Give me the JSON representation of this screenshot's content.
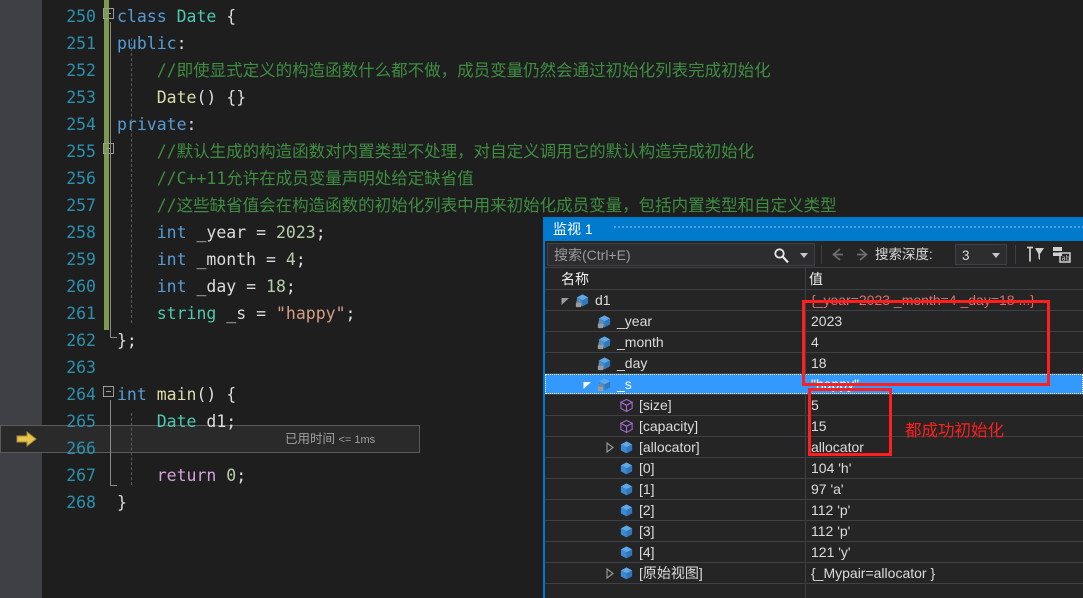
{
  "editor": {
    "lines": [
      {
        "num": "250",
        "tokens": [
          {
            "t": "class ",
            "c": "kw"
          },
          {
            "t": "Date",
            "c": "cls"
          },
          {
            "t": " {",
            "c": "plain"
          }
        ],
        "indent": 0
      },
      {
        "num": "251",
        "tokens": [
          {
            "t": "public",
            "c": "kw"
          },
          {
            "t": ":",
            "c": "plain"
          }
        ],
        "indent": 0
      },
      {
        "num": "252",
        "tokens": [
          {
            "t": "    //即使显式定义的构造函数什么都不做，成员变量仍然会通过初始化列表完成初始化",
            "c": "cmt"
          }
        ],
        "indent": 0
      },
      {
        "num": "253",
        "tokens": [
          {
            "t": "    ",
            "c": "plain"
          },
          {
            "t": "Date",
            "c": "fn"
          },
          {
            "t": "() {}",
            "c": "plain"
          }
        ],
        "indent": 0
      },
      {
        "num": "254",
        "tokens": [
          {
            "t": "private",
            "c": "kw"
          },
          {
            "t": ":",
            "c": "plain"
          }
        ],
        "indent": 0
      },
      {
        "num": "255",
        "tokens": [
          {
            "t": "    //默认生成的构造函数对内置类型不处理，对自定义调用它的默认构造完成初始化",
            "c": "cmt"
          }
        ],
        "indent": 0
      },
      {
        "num": "256",
        "tokens": [
          {
            "t": "    //C++11允许在成员变量声明处给定缺省值",
            "c": "cmt"
          }
        ],
        "indent": 0
      },
      {
        "num": "257",
        "tokens": [
          {
            "t": "    //这些缺省值会在构造函数的初始化列表中用来初始化成员变量，包括内置类型和自定义类型",
            "c": "cmt"
          }
        ],
        "indent": 0
      },
      {
        "num": "258",
        "tokens": [
          {
            "t": "    ",
            "c": "plain"
          },
          {
            "t": "int",
            "c": "kw"
          },
          {
            "t": " _year = ",
            "c": "plain"
          },
          {
            "t": "2023",
            "c": "num"
          },
          {
            "t": ";",
            "c": "plain"
          }
        ],
        "indent": 0
      },
      {
        "num": "259",
        "tokens": [
          {
            "t": "    ",
            "c": "plain"
          },
          {
            "t": "int",
            "c": "kw"
          },
          {
            "t": " _month = ",
            "c": "plain"
          },
          {
            "t": "4",
            "c": "num"
          },
          {
            "t": ";",
            "c": "plain"
          }
        ],
        "indent": 0
      },
      {
        "num": "260",
        "tokens": [
          {
            "t": "    ",
            "c": "plain"
          },
          {
            "t": "int",
            "c": "kw"
          },
          {
            "t": " _day = ",
            "c": "plain"
          },
          {
            "t": "18",
            "c": "num"
          },
          {
            "t": ";",
            "c": "plain"
          }
        ],
        "indent": 0
      },
      {
        "num": "261",
        "tokens": [
          {
            "t": "    ",
            "c": "plain"
          },
          {
            "t": "string",
            "c": "type"
          },
          {
            "t": " _s = ",
            "c": "plain"
          },
          {
            "t": "\"happy\"",
            "c": "str"
          },
          {
            "t": ";",
            "c": "plain"
          }
        ],
        "indent": 0
      },
      {
        "num": "262",
        "tokens": [
          {
            "t": "};",
            "c": "plain"
          }
        ],
        "indent": 0
      },
      {
        "num": "263",
        "tokens": [],
        "indent": 0
      },
      {
        "num": "264",
        "tokens": [
          {
            "t": "int",
            "c": "kw"
          },
          {
            "t": " ",
            "c": "plain"
          },
          {
            "t": "main",
            "c": "fn"
          },
          {
            "t": "() {",
            "c": "plain"
          }
        ],
        "indent": 0
      },
      {
        "num": "265",
        "tokens": [
          {
            "t": "    ",
            "c": "plain"
          },
          {
            "t": "Date",
            "c": "cls"
          },
          {
            "t": " d1;",
            "c": "plain"
          }
        ],
        "indent": 0
      },
      {
        "num": "266",
        "tokens": [],
        "indent": 0
      },
      {
        "num": "267",
        "tokens": [
          {
            "t": "    ",
            "c": "plain"
          },
          {
            "t": "return",
            "c": "ctl"
          },
          {
            "t": " ",
            "c": "plain"
          },
          {
            "t": "0",
            "c": "num"
          },
          {
            "t": ";",
            "c": "plain"
          }
        ],
        "indent": 0
      },
      {
        "num": "268",
        "tokens": [
          {
            "t": "}",
            "c": "plain"
          }
        ],
        "indent": 0
      }
    ],
    "elapsed_label": "已用时间",
    "elapsed_value": "<= 1ms",
    "current_line_marker": "execution-pointer-arrow"
  },
  "watch": {
    "title": "监视 1",
    "search_placeholder": "搜索(Ctrl+E)",
    "depth_label": "搜索深度:",
    "depth_value": "3",
    "columns": {
      "name": "名称",
      "value": "值"
    },
    "rows": [
      {
        "indent": 0,
        "expander": "expanded",
        "icon": "blue-cube-lock-icon",
        "name": "d1",
        "value": "{_year=2023 _month=4 _day=18 ...}",
        "changed": true,
        "selected": false
      },
      {
        "indent": 1,
        "expander": "none",
        "icon": "blue-cube-lock-icon",
        "name": "_year",
        "value": "2023",
        "changed": false,
        "selected": false
      },
      {
        "indent": 1,
        "expander": "none",
        "icon": "blue-cube-lock-icon",
        "name": "_month",
        "value": "4",
        "changed": false,
        "selected": false
      },
      {
        "indent": 1,
        "expander": "none",
        "icon": "blue-cube-lock-icon",
        "name": "_day",
        "value": "18",
        "changed": false,
        "selected": false
      },
      {
        "indent": 1,
        "expander": "expanded",
        "icon": "blue-cube-lock-icon",
        "name": "_s",
        "value": "\"happy\"",
        "changed": false,
        "selected": true
      },
      {
        "indent": 2,
        "expander": "none",
        "icon": "purple-cube-icon",
        "name": "[size]",
        "value": "5",
        "changed": false,
        "selected": false
      },
      {
        "indent": 2,
        "expander": "none",
        "icon": "purple-cube-icon",
        "name": "[capacity]",
        "value": "15",
        "changed": false,
        "selected": false
      },
      {
        "indent": 2,
        "expander": "collapsed",
        "icon": "blue-cube-icon",
        "name": "[allocator]",
        "value": "allocator",
        "changed": false,
        "selected": false
      },
      {
        "indent": 2,
        "expander": "none",
        "icon": "blue-cube-icon",
        "name": "[0]",
        "value": "104 'h'",
        "changed": false,
        "selected": false
      },
      {
        "indent": 2,
        "expander": "none",
        "icon": "blue-cube-icon",
        "name": "[1]",
        "value": "97 'a'",
        "changed": false,
        "selected": false
      },
      {
        "indent": 2,
        "expander": "none",
        "icon": "blue-cube-icon",
        "name": "[2]",
        "value": "112 'p'",
        "changed": false,
        "selected": false
      },
      {
        "indent": 2,
        "expander": "none",
        "icon": "blue-cube-icon",
        "name": "[3]",
        "value": "112 'p'",
        "changed": false,
        "selected": false
      },
      {
        "indent": 2,
        "expander": "none",
        "icon": "blue-cube-icon",
        "name": "[4]",
        "value": "121 'y'",
        "changed": false,
        "selected": false
      },
      {
        "indent": 2,
        "expander": "collapsed",
        "icon": "blue-cube-icon",
        "name": "[原始视图]",
        "value": "{_Mypair=allocator }",
        "changed": false,
        "selected": false
      }
    ]
  },
  "annotation": {
    "note": "都成功初始化",
    "color": "#ff1f1f"
  },
  "colors": {
    "editor_bg": "#1e1e1e",
    "gutter_bg": "#3f3f46",
    "line_number": "#2b91af",
    "comment": "#3e8e41",
    "keyword": "#569cd6",
    "type": "#4ec9b0",
    "string": "#d69d85",
    "number": "#b5cea8",
    "watch_title_bg": "#007acc",
    "selection_bg": "#3399ff",
    "change_bar": "#7f9a4e",
    "annotation_red": "#ff1f1f"
  }
}
